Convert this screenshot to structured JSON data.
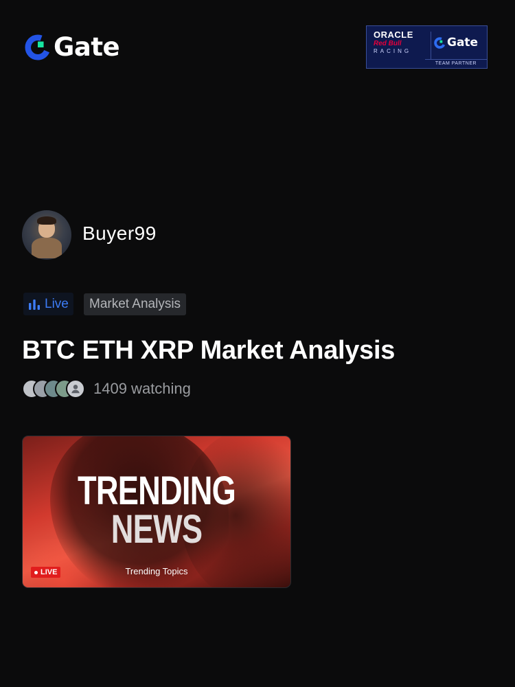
{
  "header": {
    "brand": "Gate",
    "partner": {
      "oracle": "ORACLE",
      "redbull": "Red Bull",
      "racing": "RACING",
      "gate": "Gate",
      "tagline": "TEAM PARTNER"
    }
  },
  "streamer": {
    "name": "Buyer99"
  },
  "tags": {
    "live_label": "Live",
    "category": "Market Analysis"
  },
  "stream": {
    "title": "BTC ETH XRP Market Analysis",
    "viewer_count": "1409",
    "viewer_suffix": "watching",
    "watching_text": "1409 watching"
  },
  "thumbnail": {
    "line1": "TRENDING",
    "line2": "NEWS",
    "live_badge": "LIVE",
    "caption": "Trending Topics"
  },
  "colors": {
    "background": "#0b0b0c",
    "brand_blue": "#2354e6",
    "brand_green": "#17e6a1",
    "live_blue": "#3d7cf5",
    "live_red": "#e11d1d"
  },
  "icons": {
    "brand": "gate-logo-icon",
    "live": "bar-chart-icon",
    "viewer": "user-icon"
  }
}
